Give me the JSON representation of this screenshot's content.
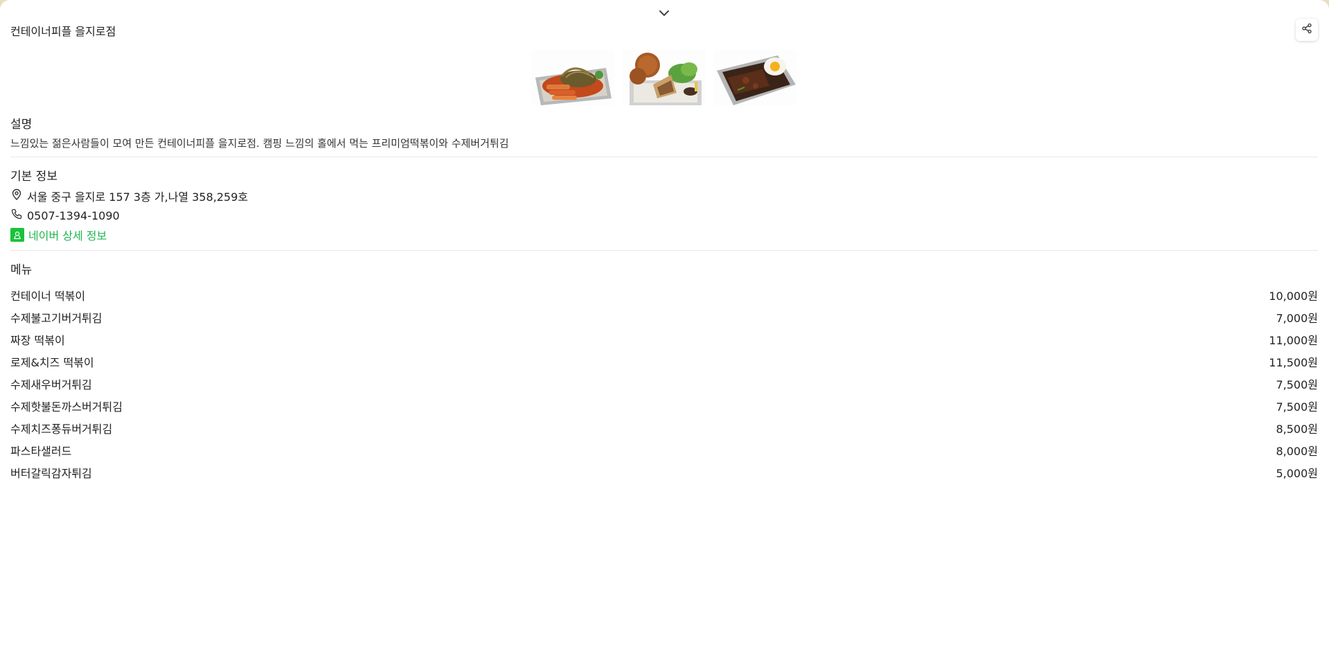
{
  "place": {
    "name": "컨테이너피플 을지로점"
  },
  "photos": [
    {
      "alt": "tteokbokki-dish"
    },
    {
      "alt": "burger-fries-dish"
    },
    {
      "alt": "rice-bowl-dish"
    }
  ],
  "description": {
    "title": "설명",
    "text": "느낌있는 젊은사람들이 모여 만든 컨테이너피플 을지로점. 캠핑 느낌의 홀에서 먹는 프리미엄떡볶이와 수제버거튀김"
  },
  "basic_info": {
    "title": "기본 정보",
    "address": "서울 중구 을지로 157 3층 가,나열 358,259호",
    "phone": "0507-1394-1090",
    "naver_link": "네이버 상세 정보"
  },
  "menu": {
    "title": "메뉴",
    "items": [
      {
        "name": "컨테이너 떡볶이",
        "price": "10,000원"
      },
      {
        "name": "수제불고기버거튀김",
        "price": "7,000원"
      },
      {
        "name": "짜장 떡볶이",
        "price": "11,000원"
      },
      {
        "name": "로제&치즈 떡볶이",
        "price": "11,500원"
      },
      {
        "name": "수제새우버거튀김",
        "price": "7,500원"
      },
      {
        "name": "수제핫불돈까스버거튀김",
        "price": "7,500원"
      },
      {
        "name": "수제치즈퐁듀버거튀김",
        "price": "8,500원"
      },
      {
        "name": "파스타샐러드",
        "price": "8,000원"
      },
      {
        "name": "버터갈릭감자튀김",
        "price": "5,000원"
      }
    ]
  },
  "icons": {
    "collapse": "chevron-down-icon",
    "share": "share-icon",
    "address": "map-pin-icon",
    "phone": "phone-icon",
    "naver": "naver-place-icon"
  },
  "colors": {
    "accent_green": "#1db54e",
    "naver_badge": "#19c33a"
  }
}
